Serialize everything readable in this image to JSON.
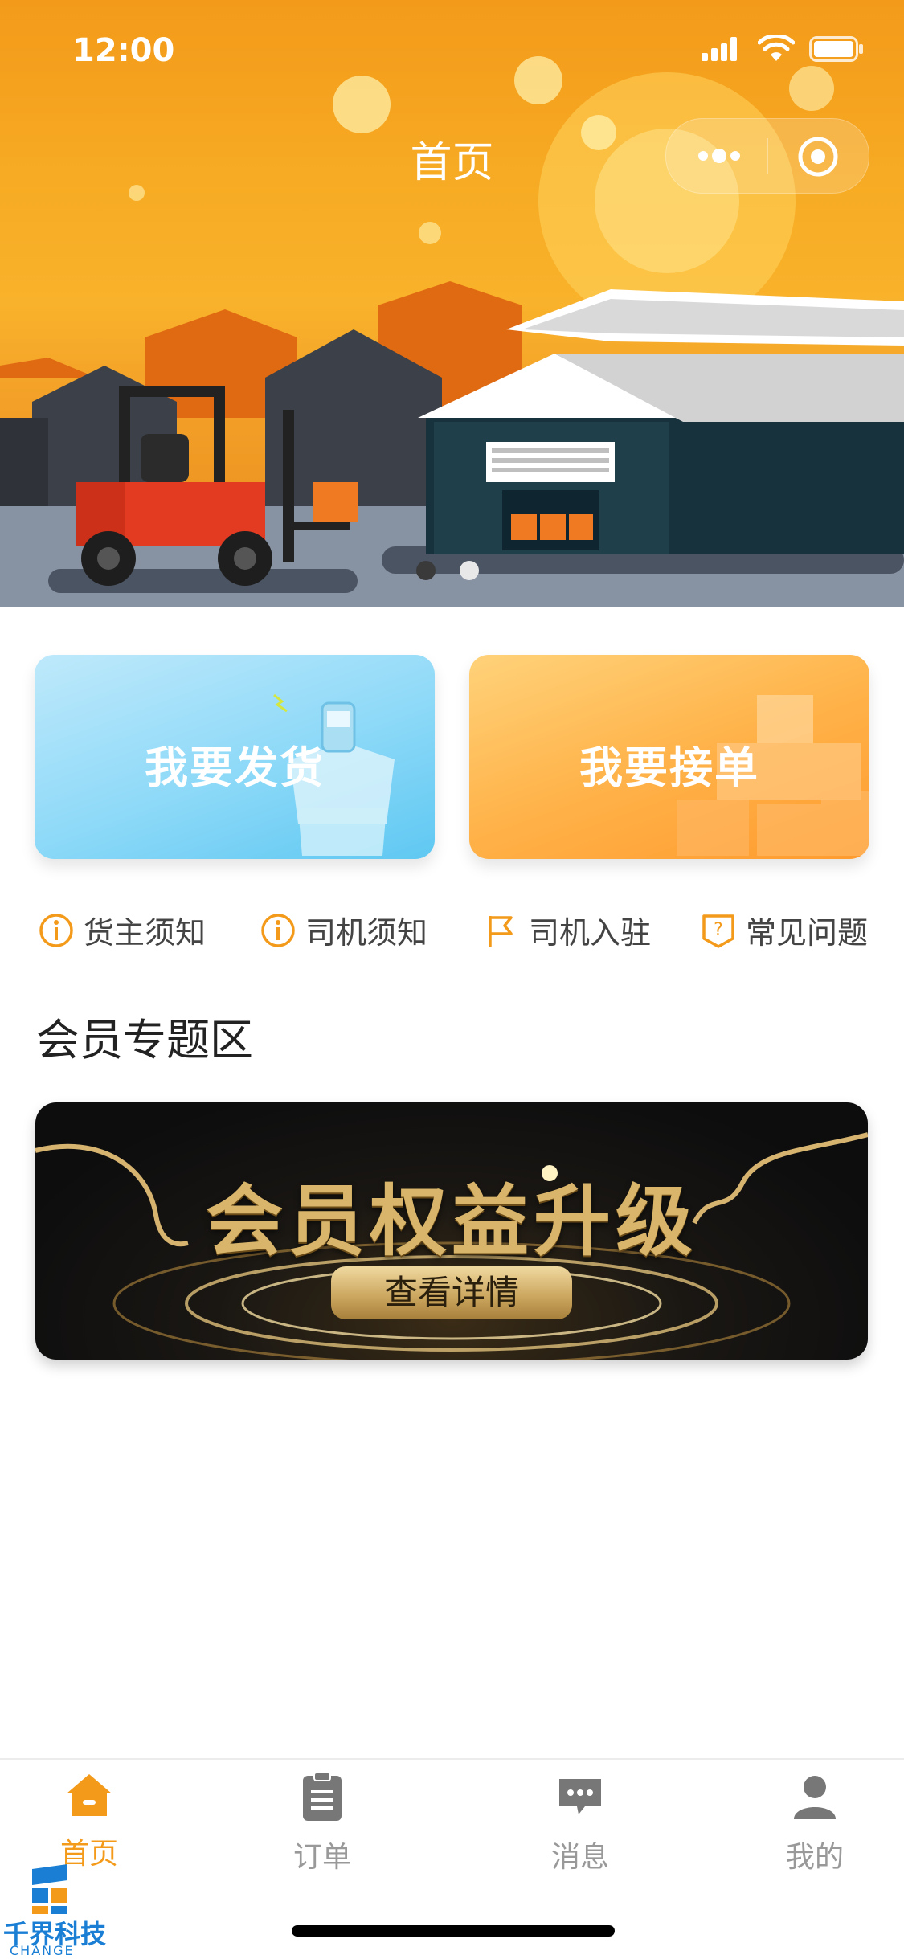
{
  "status_bar": {
    "time": "12:00"
  },
  "nav": {
    "title": "首页"
  },
  "carousel": {
    "slides": 2,
    "active_index": 1
  },
  "actions": {
    "ship_label": "我要发货",
    "take_label": "我要接单"
  },
  "quick_links": [
    {
      "label": "货主须知",
      "icon": "info-icon"
    },
    {
      "label": "司机须知",
      "icon": "info-icon"
    },
    {
      "label": "司机入驻",
      "icon": "flag-icon"
    },
    {
      "label": "常见问题",
      "icon": "question-shield-icon"
    }
  ],
  "section": {
    "title": "会员专题区"
  },
  "banner": {
    "headline": "会员权益升级",
    "button_label": "查看详情"
  },
  "tabs": [
    {
      "label": "首页",
      "icon": "home-icon",
      "active": true
    },
    {
      "label": "订单",
      "icon": "clipboard-icon",
      "active": false
    },
    {
      "label": "消息",
      "icon": "message-icon",
      "active": false
    },
    {
      "label": "我的",
      "icon": "user-icon",
      "active": false
    }
  ],
  "watermark": {
    "text": "千界科技",
    "sub": "CHANGE"
  },
  "colors": {
    "accent": "#f39a1a",
    "tab_inactive": "#999999"
  }
}
